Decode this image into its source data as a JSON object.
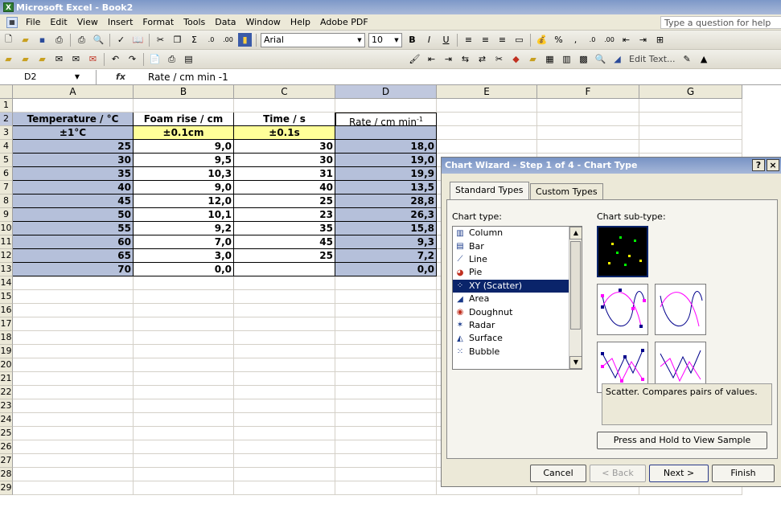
{
  "window": {
    "title": "Microsoft Excel - Book2"
  },
  "menu": {
    "items": [
      "File",
      "Edit",
      "View",
      "Insert",
      "Format",
      "Tools",
      "Data",
      "Window",
      "Help",
      "Adobe PDF"
    ],
    "question_placeholder": "Type a question for help"
  },
  "toolbar": {
    "font_name": "Arial",
    "font_size": "10",
    "edit_text_label": "Edit Text..."
  },
  "formula_bar": {
    "cell_ref": "D2",
    "fx_label": "fx",
    "content": "Rate / cm min -1"
  },
  "columns": [
    "A",
    "B",
    "C",
    "D",
    "E",
    "F",
    "G"
  ],
  "rows": [
    "1",
    "2",
    "3",
    "4",
    "5",
    "6",
    "7",
    "8",
    "9",
    "10",
    "11",
    "12",
    "13",
    "14",
    "15",
    "16",
    "17",
    "18",
    "19",
    "20",
    "21",
    "22",
    "23",
    "24",
    "25",
    "26",
    "27",
    "28",
    "29"
  ],
  "table": {
    "headers": [
      "Temperature / °C",
      "Foam rise / cm",
      "Time / s",
      "Rate / cm min"
    ],
    "rate_superscript": "-1",
    "uncertainty": [
      "±1°C",
      "±0.1cm",
      "±0.1s",
      ""
    ],
    "data": [
      [
        "25",
        "9,0",
        "30",
        "18,0"
      ],
      [
        "30",
        "9,5",
        "30",
        "19,0"
      ],
      [
        "35",
        "10,3",
        "31",
        "19,9"
      ],
      [
        "40",
        "9,0",
        "40",
        "13,5"
      ],
      [
        "45",
        "12,0",
        "25",
        "28,8"
      ],
      [
        "50",
        "10,1",
        "23",
        "26,3"
      ],
      [
        "55",
        "9,2",
        "35",
        "15,8"
      ],
      [
        "60",
        "7,0",
        "45",
        "9,3"
      ],
      [
        "65",
        "3,0",
        "25",
        "7,2"
      ],
      [
        "70",
        "0,0",
        "",
        "0,0"
      ]
    ]
  },
  "dialog": {
    "title": "Chart Wizard - Step 1 of 4 - Chart Type",
    "help_label": "?",
    "close_label": "×",
    "tabs": [
      "Standard Types",
      "Custom Types"
    ],
    "chart_type_label": "Chart type:",
    "subtype_label": "Chart sub-type:",
    "chart_types": [
      {
        "label": "Column",
        "icon": "column-chart-icon"
      },
      {
        "label": "Bar",
        "icon": "bar-chart-icon"
      },
      {
        "label": "Line",
        "icon": "line-chart-icon"
      },
      {
        "label": "Pie",
        "icon": "pie-chart-icon"
      },
      {
        "label": "XY (Scatter)",
        "icon": "scatter-chart-icon"
      },
      {
        "label": "Area",
        "icon": "area-chart-icon"
      },
      {
        "label": "Doughnut",
        "icon": "doughnut-chart-icon"
      },
      {
        "label": "Radar",
        "icon": "radar-chart-icon"
      },
      {
        "label": "Surface",
        "icon": "surface-chart-icon"
      },
      {
        "label": "Bubble",
        "icon": "bubble-chart-icon"
      }
    ],
    "description": "Scatter. Compares pairs of values.",
    "sample_button": "Press and Hold to View Sample",
    "buttons": {
      "cancel": "Cancel",
      "back": "< Back",
      "next": "Next >",
      "finish": "Finish"
    }
  }
}
